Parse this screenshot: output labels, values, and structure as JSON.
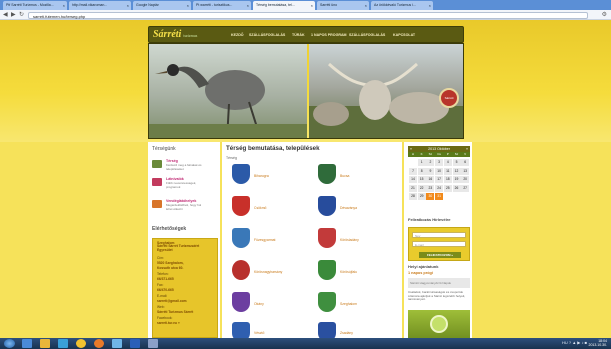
{
  "browser": {
    "tabs": [
      {
        "label": "Ptf Sarréti Turizmus - Mozilla..."
      },
      {
        "label": "http://mail.vikaroman..."
      },
      {
        "label": "Google Naptár"
      },
      {
        "label": "Pt warréti - turisztikus..."
      },
      {
        "label": "Térség bemutatása, tel..."
      },
      {
        "label": "Sarréti üno"
      },
      {
        "label": "Az örökkévaló Turizmus i..."
      }
    ],
    "url": "sarreti.futemen.hu/terseg.php"
  },
  "site": {
    "logo": "Sárréti",
    "logo_sub": "turizmus",
    "menu": [
      "KEZDŐ",
      "SZÁLLÁSFOGLALÁS",
      "TÚRÁK",
      "1 NAPOS PROGRAM",
      "SZÁLLÁSFOGLALÁS",
      "KAPCSOLAT"
    ],
    "crest_label": "Sárréti"
  },
  "left": {
    "title": "Térségünk",
    "items": [
      {
        "label": "Térség",
        "desc": "Kérdezd meg a falvakat és településeket"
      },
      {
        "label": "Látnivalók",
        "desc": "Főbb nevezetességek, programok"
      },
      {
        "label": "Vendéglátóhelyek",
        "desc": "Megérdeklődheti, hogy hol lehet étkezni"
      }
    ],
    "contact_title": "Elérhetőségek",
    "contact": [
      {
        "text": "Szeghalom",
        "value": false
      },
      {
        "text": "Sárréti Sárrét Turizmusáért Egyesület",
        "value": true
      },
      {
        "text": "Cím:",
        "value": false
      },
      {
        "text": "5520 Szeghalom,",
        "value": true
      },
      {
        "text": "Kossuth utca 60.",
        "value": true
      },
      {
        "text": "Telefon:",
        "value": false
      },
      {
        "text": "66/371-665",
        "value": true
      },
      {
        "text": "Fax:",
        "value": false
      },
      {
        "text": "66/470-665",
        "value": true
      },
      {
        "text": "E-mail:",
        "value": false
      },
      {
        "text": "sarreti@gmail.com",
        "value": true
      },
      {
        "text": "Web:",
        "value": false
      },
      {
        "text": "Sárréti Turizmus Sárrét",
        "value": true
      },
      {
        "text": "Facebook:",
        "value": false
      },
      {
        "text": "sarreti.tur.eu »",
        "value": true
      }
    ]
  },
  "main": {
    "title": "Térség bemutatása, települések",
    "subtitle": "Térség",
    "towns": [
      {
        "name": "Biharugra"
      },
      {
        "name": "Bucsa"
      },
      {
        "name": "Csökmő"
      },
      {
        "name": "Dévaványa"
      },
      {
        "name": "Füzesgyarmat"
      },
      {
        "name": "Körösladány"
      },
      {
        "name": "Körösnagyharsány"
      },
      {
        "name": "Körösújfalu"
      },
      {
        "name": "Okány"
      },
      {
        "name": "Szeghalom"
      },
      {
        "name": "Vésztő"
      },
      {
        "name": "Zsadány"
      }
    ]
  },
  "calendar": {
    "title": "2013 Október",
    "days": [
      "H",
      "K",
      "Sz",
      "Cs",
      "P",
      "Sz",
      "V"
    ],
    "dates": [
      "",
      "1",
      "2",
      "3",
      "4",
      "5",
      "6",
      "7",
      "8",
      "9",
      "10",
      "11",
      "12",
      "13",
      "14",
      "15",
      "16",
      "17",
      "18",
      "19",
      "20",
      "21",
      "22",
      "23",
      "24",
      "25",
      "26",
      "27",
      "28",
      "29",
      "30",
      "31",
      "",
      "",
      ""
    ],
    "highlight": [
      "30",
      "31"
    ]
  },
  "newsletter": {
    "title": "Feliratkozás Hírlevélre",
    "name_placeholder": "Név",
    "email_placeholder": "E-mail",
    "button": "FELIRATKOZOM »"
  },
  "tips": {
    "title": "Helyi ajánlatunk",
    "subtitle": "1 napos prógi",
    "box_text": "Sárréti Hagyományőrző Napok",
    "paragraph": "Családok, baráti társaságok és csoportok számára ajánljuk a Sárrét legszebb helyeit, tanösvényeit."
  },
  "taskbar": {
    "tray_icons": "HU ? ▲ ▶ ♪ ■",
    "time": "18:04",
    "date": "2013.10.30."
  },
  "colors": {
    "site_yellow": "#f6e25a",
    "nav_olive": "#5a5a12",
    "link_magenta": "#c02873",
    "town_orange": "#c97a1a",
    "calendar_highlight": "#f28a1a"
  }
}
